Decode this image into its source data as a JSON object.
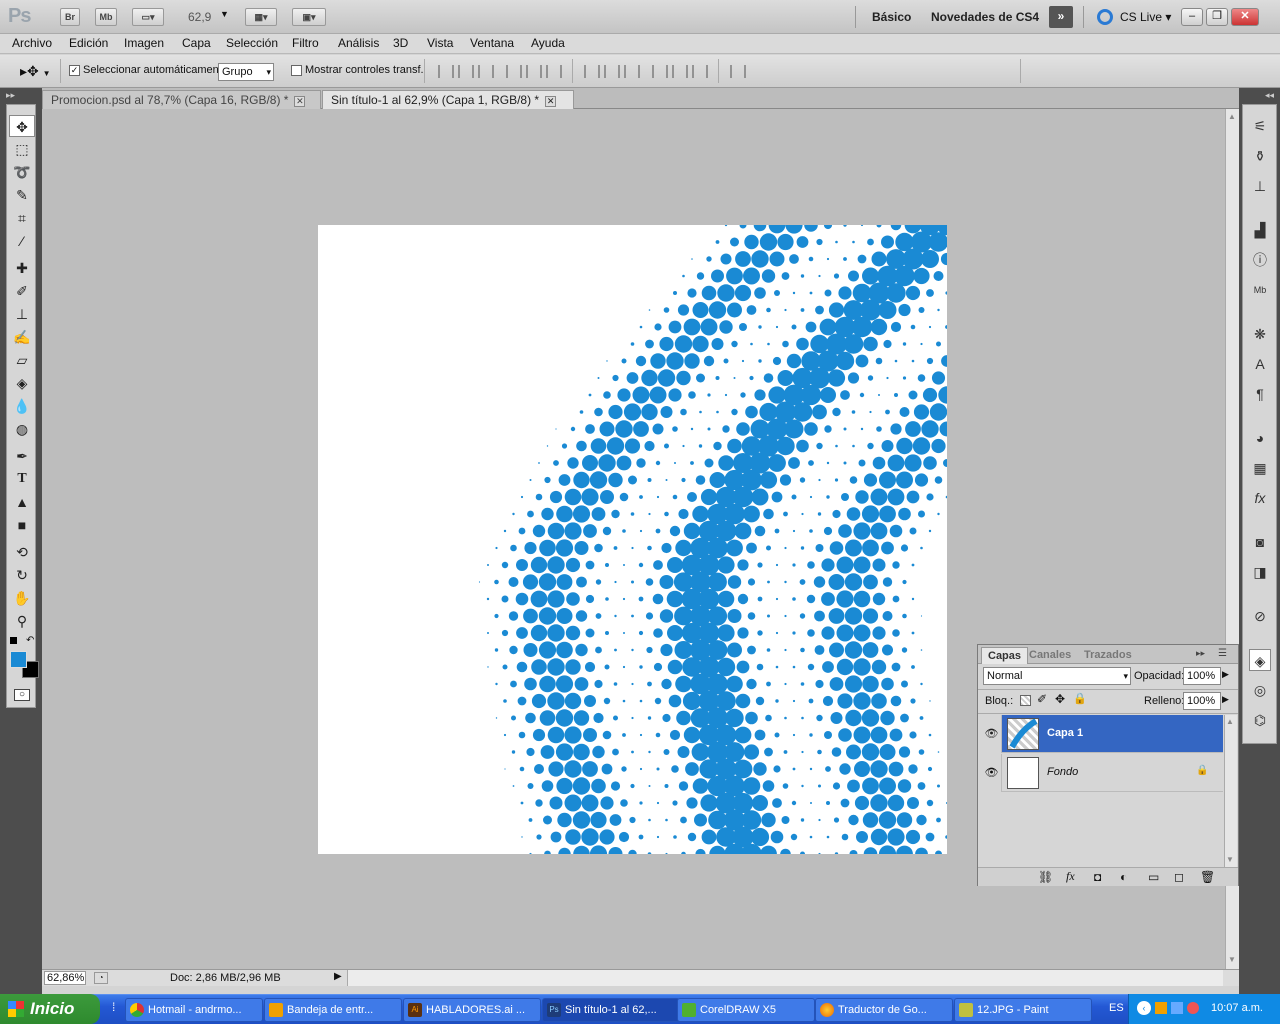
{
  "app": {
    "logo": "Ps",
    "bridge_btn": "Br",
    "minibridge_btn": "Mb",
    "zoom_value": "62,9",
    "workspace_basic": "Básico",
    "workspace_new": "Novedades de CS4",
    "cslive": "CS Live"
  },
  "menu": [
    "Archivo",
    "Edición",
    "Imagen",
    "Capa",
    "Selección",
    "Filtro",
    "Análisis",
    "3D",
    "Vista",
    "Ventana",
    "Ayuda"
  ],
  "options": {
    "autoselect_label": "Seleccionar automáticamente:",
    "autoselect_checked": true,
    "autoselect_value": "Grupo",
    "transform_label": "Mostrar controles transf.",
    "transform_checked": false
  },
  "tabs": [
    {
      "label": "Promocion.psd al 78,7% (Capa 16, RGB/8) *",
      "active": false
    },
    {
      "label": "Sin título-1 al 62,9% (Capa 1, RGB/8) *",
      "active": true
    }
  ],
  "status": {
    "zoom": "62,86%",
    "doc": "Doc: 2,86 MB/2,96 MB"
  },
  "colors": {
    "foreground": "#1a8ad4",
    "background": "#000000",
    "halftone": "#1a8ad4"
  },
  "layers_panel": {
    "tabs": [
      "Capas",
      "Canales",
      "Trazados"
    ],
    "blend_mode": "Normal",
    "opacity_label": "Opacidad:",
    "opacity_value": "100%",
    "lock_label": "Bloq.:",
    "fill_label": "Relleno:",
    "fill_value": "100%",
    "layers": [
      {
        "name": "Capa 1",
        "selected": true,
        "locked": false
      },
      {
        "name": "Fondo",
        "selected": false,
        "locked": true
      }
    ]
  },
  "taskbar": {
    "start": "Inicio",
    "items": [
      {
        "label": "Hotmail - andrmo...",
        "icon_color": "#e8b020",
        "active": false
      },
      {
        "label": "Bandeja de entr...",
        "icon_color": "#f0a000",
        "active": false
      },
      {
        "label": "HABLADORES.ai ...",
        "icon_color": "#e07010",
        "active": false
      },
      {
        "label": "Sin título-1 al 62,...",
        "icon_color": "#1e3c78",
        "active": true
      },
      {
        "label": "CorelDRAW X5",
        "icon_color": "#50b030",
        "active": false
      },
      {
        "label": "Traductor de Go...",
        "icon_color": "#e06010",
        "active": false
      },
      {
        "label": "12.JPG - Paint",
        "icon_color": "#c0c040",
        "active": false
      }
    ],
    "lang": "ES",
    "clock": "10:07 a.m."
  }
}
